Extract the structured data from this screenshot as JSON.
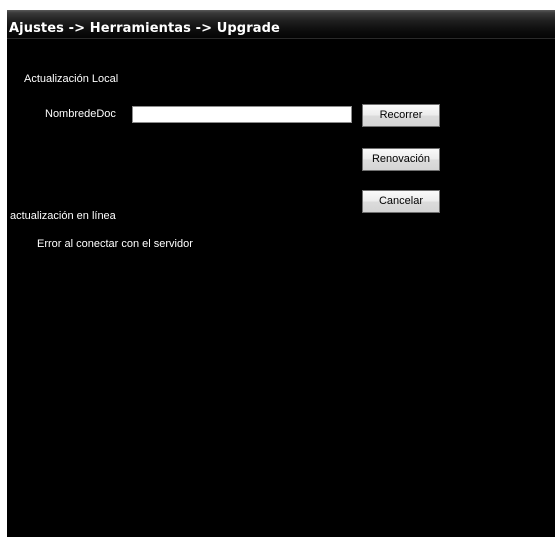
{
  "header": {
    "breadcrumb": "Ajustes -> Herramientas -> Upgrade"
  },
  "local_update": {
    "section_label": "Actualización Local",
    "file_label": "NombredeDoc",
    "file_value": "",
    "browse_label": "Recorrer",
    "renew_label": "Renovación",
    "cancel_label": "Cancelar"
  },
  "online_update": {
    "section_label": "actualización en línea",
    "status_text": "Error al conectar con el servidor"
  },
  "colors": {
    "background": "#000000",
    "text": "#ffffff",
    "button_face": "#e6e6e6"
  }
}
